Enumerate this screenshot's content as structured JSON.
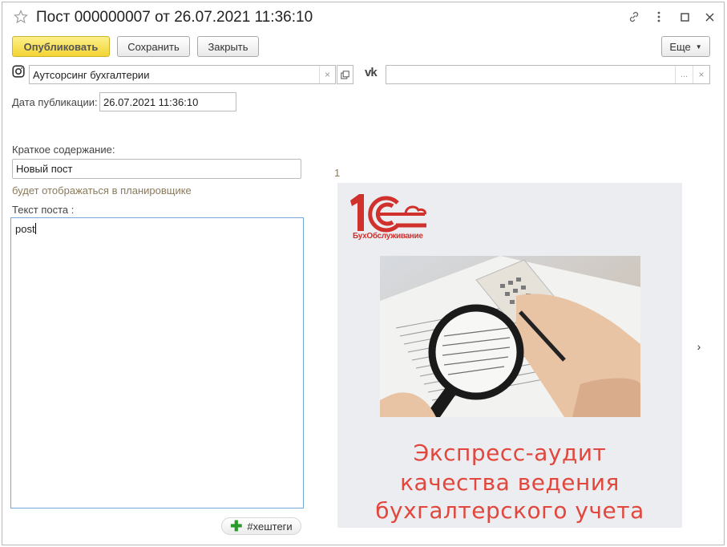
{
  "window": {
    "title": "Пост 000000007 от 26.07.2021 11:36:10"
  },
  "toolbar": {
    "publish_label": "Опубликовать",
    "save_label": "Сохранить",
    "close_label": "Закрыть",
    "more_label": "Еще"
  },
  "accounts": {
    "instagram_icon": "instagram-icon",
    "instagram_value": "Аутсорсинг бухгалтерии",
    "vk_icon_text": "vk",
    "vk_value": "",
    "clear_glyph": "×",
    "choose_glyph": "..."
  },
  "form": {
    "date_label": "Дата публикации:",
    "date_value": "26.07.2021 11:36:10",
    "summary_label": "Краткое содержание:",
    "summary_value": "Новый пост",
    "summary_hint": "будет отображаться в планировщике",
    "text_label": "Текст поста :",
    "text_value": "post",
    "hashtag_button": "#хештеги"
  },
  "gallery": {
    "index": "1",
    "logo_sub": "БухОбслуживание",
    "caption_lines": [
      "Экспресс-аудит",
      "качества ведения",
      "бухгалтерского учета"
    ],
    "next_glyph": "›"
  },
  "colors": {
    "accent_yellow": "#f3d433",
    "brand_red": "#d0312d",
    "caption_red": "#e2473e",
    "focus_blue": "#77a6d8",
    "hint_brown": "#8a7a5c"
  }
}
